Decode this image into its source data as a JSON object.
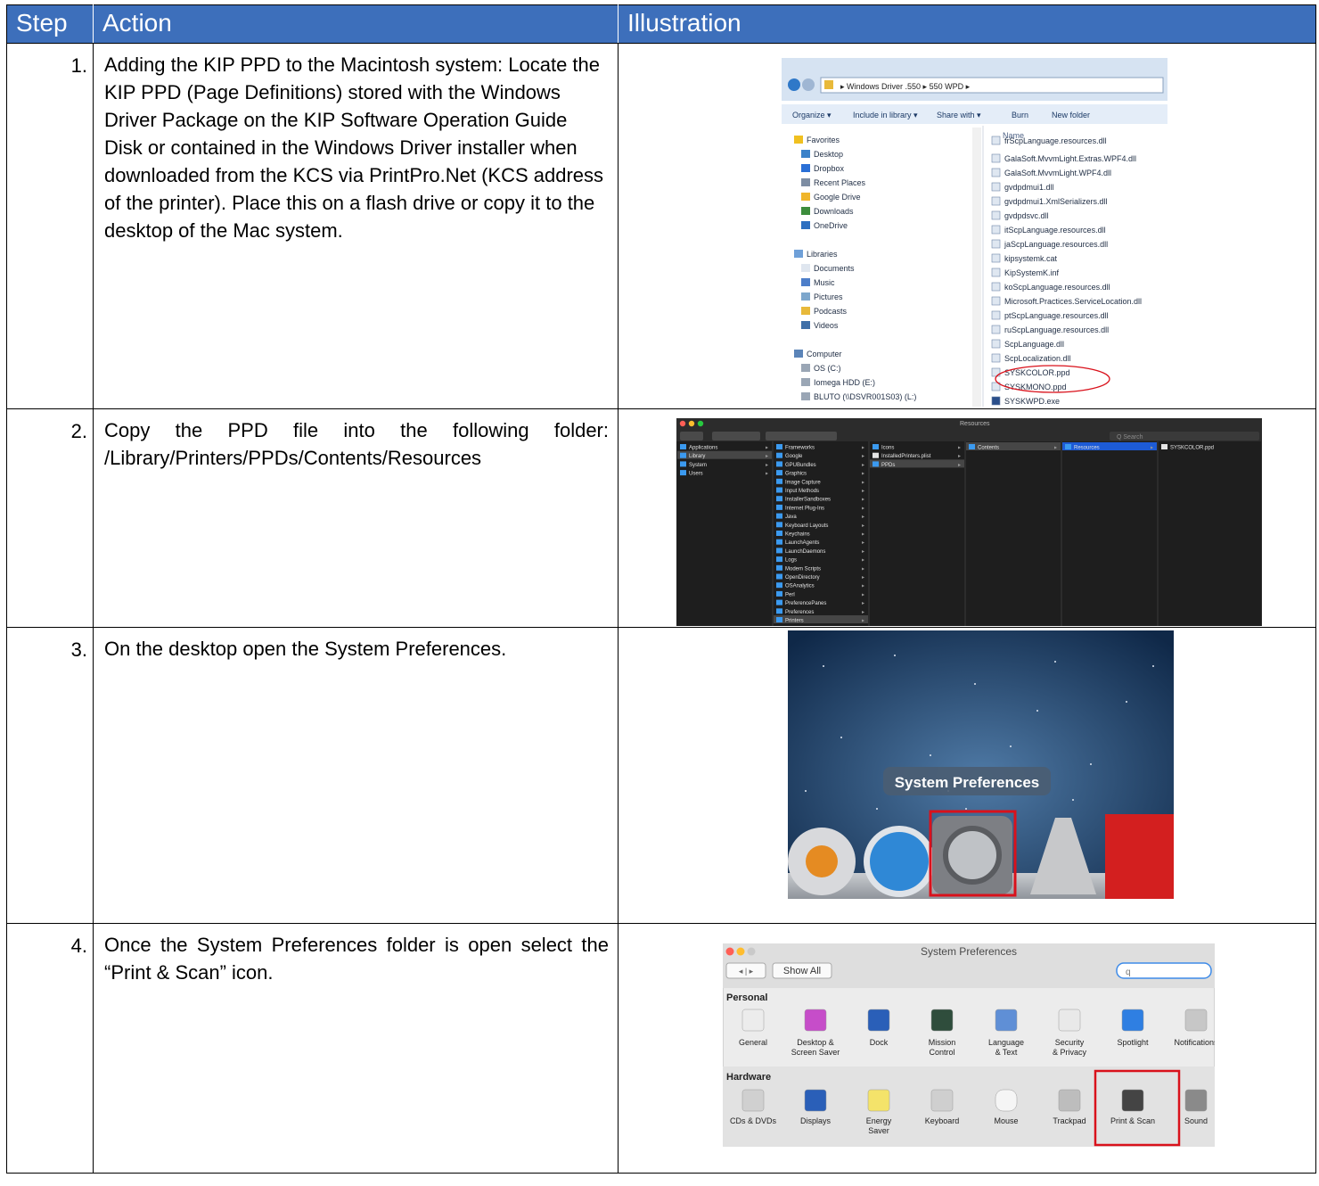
{
  "table": {
    "headers": [
      "Step",
      "Action",
      "Illustration"
    ]
  },
  "steps": [
    {
      "number": "1.",
      "action": "Adding the KIP PPD to the Macintosh system: Locate the KIP PPD (Page Definitions) stored with the Windows Driver Package on the KIP Software Operation Guide Disk or contained in the Windows Driver installer when downloaded from the KCS via PrintPro.Net (KCS address of the printer).   Place this on a flash drive or copy it to the desktop of the Mac system."
    },
    {
      "number": "2.",
      "action": "Copy the PPD file into the following folder: /Library/Printers/PPDs/Contents/Resources"
    },
    {
      "number": "3.",
      "action": "On the desktop open the System Preferences."
    },
    {
      "number": "4.",
      "action": "Once the System Preferences folder is open select the “Print & Scan” icon."
    }
  ],
  "explorer": {
    "breadcrumb": [
      "Windows Driver .550",
      "550 WPD"
    ],
    "toolbar": [
      "Organize ▾",
      "Include in library ▾",
      "Share with ▾",
      "Burn",
      "New folder"
    ],
    "column_header": "Name",
    "favorites_title": "Favorites",
    "favorites": [
      "Desktop",
      "Dropbox",
      "Recent Places",
      "Google Drive",
      "Downloads",
      "OneDrive"
    ],
    "libraries_title": "Libraries",
    "libraries": [
      "Documents",
      "Music",
      "Pictures",
      "Podcasts",
      "Videos"
    ],
    "computer_title": "Computer",
    "drives": [
      "OS (C:)",
      "Iomega HDD (E:)",
      "BLUTO (\\\\DSVR001S03) (L:)"
    ],
    "files": [
      "frScpLanguage.resources.dll",
      "GalaSoft.MvvmLight.Extras.WPF4.dll",
      "GalaSoft.MvvmLight.WPF4.dll",
      "gvdpdmui1.dll",
      "gvdpdmui1.XmlSerializers.dll",
      "gvdpdsvc.dll",
      "itScpLanguage.resources.dll",
      "jaScpLanguage.resources.dll",
      "kipsystemk.cat",
      "KipSystemK.inf",
      "koScpLanguage.resources.dll",
      "Microsoft.Practices.ServiceLocation.dll",
      "ptScpLanguage.resources.dll",
      "ruScpLanguage.resources.dll",
      "ScpLanguage.dll",
      "ScpLocalization.dll",
      "SYSKCOLOR.ppd",
      "SYSKMONO.ppd",
      "SYSKWPD.exe"
    ]
  },
  "finder": {
    "title": "Resources",
    "search_placeholder": "Search",
    "col1": [
      "Applications",
      "Library",
      "System",
      "Users"
    ],
    "col2": [
      "Frameworks",
      "Google",
      "GPUBundles",
      "Graphics",
      "Image Capture",
      "Input Methods",
      "InstallerSandboxes",
      "Internet Plug-Ins",
      "Java",
      "Keyboard Layouts",
      "Keychains",
      "LaunchAgents",
      "LaunchDaemons",
      "Logs",
      "Modem Scripts",
      "OpenDirectory",
      "OSAnalytics",
      "Perl",
      "PreferencePanes",
      "Preferences",
      "Printers"
    ],
    "col3": [
      "Icons",
      "InstalledPrinters.plist",
      "PPDs"
    ],
    "col4": [
      "Contents"
    ],
    "col5": [
      "Resources"
    ],
    "col6": [
      "SYSKCOLOR.ppd"
    ]
  },
  "dock": {
    "tooltip": "System Preferences"
  },
  "syspref": {
    "title": "System Preferences",
    "show_all": "Show All",
    "personal_title": "Personal",
    "personal": [
      [
        "General",
        ""
      ],
      [
        "Desktop &",
        "Screen Saver"
      ],
      [
        "Dock",
        ""
      ],
      [
        "Mission",
        "Control"
      ],
      [
        "Language",
        "& Text"
      ],
      [
        "Security",
        "& Privacy"
      ],
      [
        "Spotlight",
        ""
      ],
      [
        "Notifications",
        ""
      ]
    ],
    "hardware_title": "Hardware",
    "hardware": [
      [
        "CDs & DVDs",
        ""
      ],
      [
        "Displays",
        ""
      ],
      [
        "Energy",
        "Saver"
      ],
      [
        "Keyboard",
        ""
      ],
      [
        "Mouse",
        ""
      ],
      [
        "Trackpad",
        ""
      ],
      [
        "Print & Scan",
        ""
      ],
      [
        "Sound",
        ""
      ]
    ]
  },
  "colors": {
    "header_bg": "#3d6fbb",
    "highlight_red": "#d9111b",
    "finder_select": "#1d5bd6"
  }
}
